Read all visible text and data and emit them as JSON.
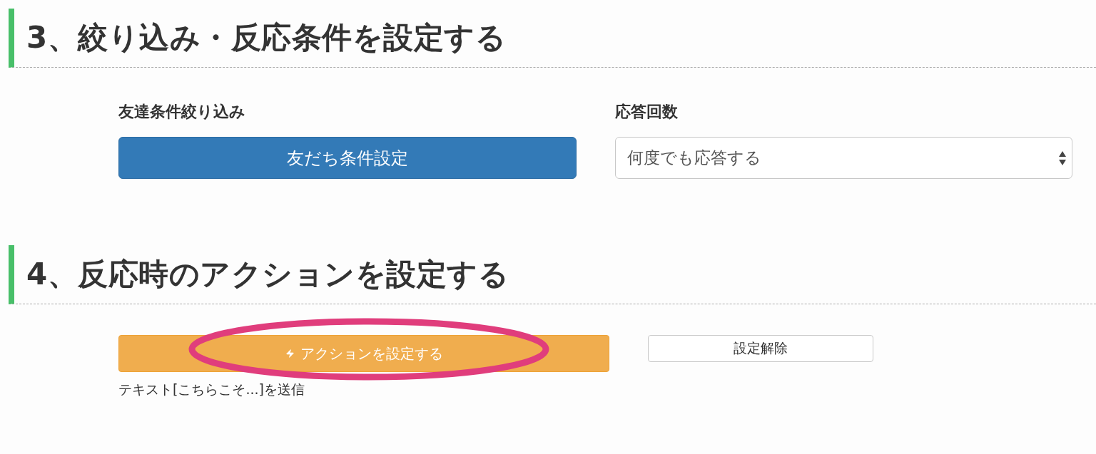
{
  "sections": [
    {
      "kind": "conditions",
      "heading": "3、絞り込み・反応条件を設定する",
      "friend_filter": {
        "label": "友達条件絞り込み",
        "button": "友だち条件設定"
      },
      "response_count": {
        "label": "応答回数",
        "value": "何度でも応答する"
      }
    },
    {
      "kind": "action",
      "heading": "4、反応時のアクションを設定する",
      "action_button": "アクションを設定する",
      "clear_button": "設定解除",
      "summary": "テキスト[こちらこそ...]を送信"
    }
  ]
}
